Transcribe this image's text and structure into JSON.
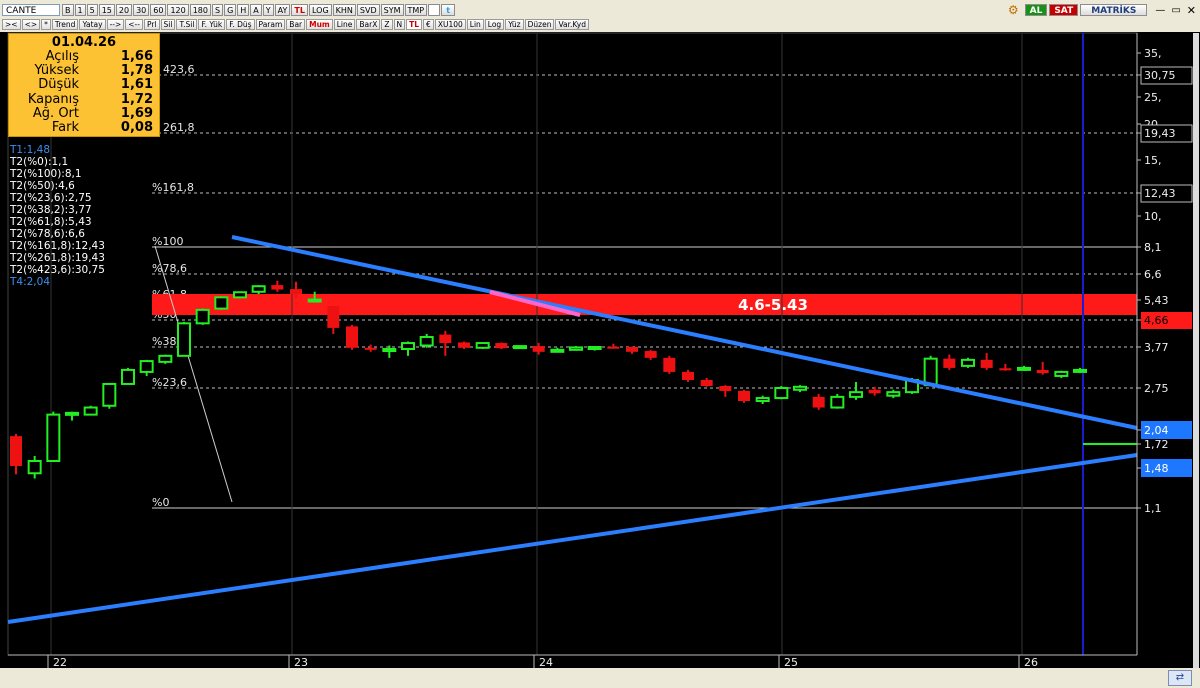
{
  "toolbar": {
    "symbol": "CANTE",
    "row1_buttons": [
      "B",
      "1",
      "5",
      "15",
      "20",
      "30",
      "60",
      "120",
      "180",
      "S",
      "G",
      "H",
      "A",
      "Y",
      "AY",
      "TL",
      "LOG",
      "KHN",
      "SVD",
      "SYM",
      "TMP"
    ],
    "row1_red": [
      "TL"
    ],
    "row2_buttons": [
      "><",
      "<>",
      "*",
      "Trend",
      "Yatay",
      "-->",
      "<--",
      "Prl",
      "Sil",
      "T.Sil",
      "F. Yük",
      "F. Düş",
      "Param",
      "Bar",
      "Mum",
      "Line",
      "BarX",
      "Z",
      "N",
      "TL",
      "€",
      "XU100",
      "Lin",
      "Log",
      "Yüz",
      "Düzen",
      "Var.Kyd"
    ],
    "row2_red": [
      "Mum",
      "TL"
    ],
    "al_label": "AL",
    "sat_label": "SAT",
    "brand": "MATRİKS"
  },
  "info": {
    "date": "01.04.26",
    "rows": [
      {
        "label": "Açılış",
        "value": "1,66"
      },
      {
        "label": "Yüksek",
        "value": "1,78"
      },
      {
        "label": "Düşük",
        "value": "1,61"
      },
      {
        "label": "Kapanış",
        "value": "1,72"
      },
      {
        "label": "Ağ. Ort",
        "value": "1,69"
      },
      {
        "label": "Fark",
        "value": "0,08"
      }
    ]
  },
  "fibonacci": {
    "t1": "T1:1,48",
    "levels": [
      "T2(%0):1,1",
      "T2(%100):8,1",
      "T2(%50):4,6",
      "T2(%23,6):2,75",
      "T2(%38,2):3,77",
      "T2(%61,8):5,43",
      "T2(%78,6):6,6",
      "T2(%161,8):12,43",
      "T2(%261,8):19,43",
      "T2(%423,6):30,75"
    ],
    "t4": "T4:2,04",
    "line_labels": [
      "423,6",
      "261,8",
      "%161,8",
      "%100",
      "%78,6",
      "%61,8",
      "%50",
      "%38,2",
      "%23,6",
      "%0"
    ]
  },
  "zone_label": "4.6-5.43",
  "price_axis": {
    "ticks": [
      "35,",
      "30,75",
      "25,",
      "20,",
      "19,43",
      "15,",
      "12,43",
      "10,",
      "8,1",
      "6,6",
      "5,43",
      "4,66",
      "3,77",
      "2,75",
      "2,04",
      "1,72",
      "1,48",
      "1,1"
    ],
    "highlight_red": "4,66",
    "highlight_blue": [
      "2,04",
      "1,48"
    ]
  },
  "date_axis": [
    "22",
    "23",
    "24",
    "25",
    "26"
  ],
  "colors": {
    "up": "#22ee22",
    "down": "#ee1111",
    "trend": "#2b7fff",
    "zone": "#ff1a1a",
    "info_bg": "#fdc234",
    "cursor": "#1b1bd0"
  },
  "chart_data": {
    "type": "candlestick",
    "candles": [
      {
        "o": 1.9,
        "h": 1.95,
        "l": 1.42,
        "c": 1.5
      },
      {
        "o": 1.43,
        "h": 1.6,
        "l": 1.38,
        "c": 1.55
      },
      {
        "o": 1.55,
        "h": 2.35,
        "l": 1.55,
        "c": 2.3
      },
      {
        "o": 2.3,
        "h": 2.35,
        "l": 2.2,
        "c": 2.33
      },
      {
        "o": 2.3,
        "h": 2.45,
        "l": 2.3,
        "c": 2.42
      },
      {
        "o": 2.45,
        "h": 2.85,
        "l": 2.4,
        "c": 2.85
      },
      {
        "o": 2.85,
        "h": 3.25,
        "l": 2.85,
        "c": 3.2
      },
      {
        "o": 3.15,
        "h": 3.45,
        "l": 3.05,
        "c": 3.42
      },
      {
        "o": 3.4,
        "h": 3.58,
        "l": 3.35,
        "c": 3.55
      },
      {
        "o": 3.55,
        "h": 4.6,
        "l": 3.55,
        "c": 4.55
      },
      {
        "o": 4.55,
        "h": 5.1,
        "l": 4.5,
        "c": 5.05
      },
      {
        "o": 5.1,
        "h": 5.6,
        "l": 5.05,
        "c": 5.55
      },
      {
        "o": 5.55,
        "h": 5.8,
        "l": 5.5,
        "c": 5.78
      },
      {
        "o": 5.8,
        "h": 6.1,
        "l": 5.7,
        "c": 6.05
      },
      {
        "o": 6.1,
        "h": 6.3,
        "l": 5.8,
        "c": 5.9
      },
      {
        "o": 5.92,
        "h": 6.25,
        "l": 5.5,
        "c": 5.7
      },
      {
        "o": 5.45,
        "h": 5.8,
        "l": 5.35,
        "c": 5.45
      },
      {
        "o": 5.2,
        "h": 5.2,
        "l": 4.2,
        "c": 4.4
      },
      {
        "o": 4.45,
        "h": 4.5,
        "l": 3.7,
        "c": 3.75
      },
      {
        "o": 3.75,
        "h": 3.85,
        "l": 3.65,
        "c": 3.7
      },
      {
        "o": 3.7,
        "h": 3.82,
        "l": 3.5,
        "c": 3.72
      },
      {
        "o": 3.72,
        "h": 3.95,
        "l": 3.55,
        "c": 3.9
      },
      {
        "o": 3.82,
        "h": 4.2,
        "l": 3.75,
        "c": 4.1
      },
      {
        "o": 4.18,
        "h": 4.3,
        "l": 3.55,
        "c": 3.9
      },
      {
        "o": 3.92,
        "h": 3.95,
        "l": 3.72,
        "c": 3.75
      },
      {
        "o": 3.75,
        "h": 3.92,
        "l": 3.72,
        "c": 3.9
      },
      {
        "o": 3.9,
        "h": 3.92,
        "l": 3.72,
        "c": 3.74
      },
      {
        "o": 3.76,
        "h": 3.82,
        "l": 3.72,
        "c": 3.8
      },
      {
        "o": 3.8,
        "h": 3.9,
        "l": 3.58,
        "c": 3.65
      },
      {
        "o": 3.67,
        "h": 3.75,
        "l": 3.65,
        "c": 3.7
      },
      {
        "o": 3.7,
        "h": 3.8,
        "l": 3.68,
        "c": 3.76
      },
      {
        "o": 3.75,
        "h": 3.8,
        "l": 3.68,
        "c": 3.77
      },
      {
        "o": 3.78,
        "h": 3.88,
        "l": 3.73,
        "c": 3.75
      },
      {
        "o": 3.77,
        "h": 3.78,
        "l": 3.6,
        "c": 3.65
      },
      {
        "o": 3.67,
        "h": 3.7,
        "l": 3.45,
        "c": 3.5
      },
      {
        "o": 3.5,
        "h": 3.55,
        "l": 3.1,
        "c": 3.15
      },
      {
        "o": 3.15,
        "h": 3.2,
        "l": 2.9,
        "c": 2.95
      },
      {
        "o": 2.95,
        "h": 3.0,
        "l": 2.78,
        "c": 2.8
      },
      {
        "o": 2.8,
        "h": 2.82,
        "l": 2.6,
        "c": 2.7
      },
      {
        "o": 2.7,
        "h": 2.72,
        "l": 2.5,
        "c": 2.53
      },
      {
        "o": 2.53,
        "h": 2.62,
        "l": 2.48,
        "c": 2.58
      },
      {
        "o": 2.58,
        "h": 2.8,
        "l": 2.56,
        "c": 2.75
      },
      {
        "o": 2.72,
        "h": 2.82,
        "l": 2.68,
        "c": 2.78
      },
      {
        "o": 2.6,
        "h": 2.65,
        "l": 2.38,
        "c": 2.42
      },
      {
        "o": 2.42,
        "h": 2.65,
        "l": 2.4,
        "c": 2.6
      },
      {
        "o": 2.6,
        "h": 2.9,
        "l": 2.55,
        "c": 2.68
      },
      {
        "o": 2.72,
        "h": 2.78,
        "l": 2.62,
        "c": 2.66
      },
      {
        "o": 2.62,
        "h": 2.72,
        "l": 2.58,
        "c": 2.68
      },
      {
        "o": 2.68,
        "h": 3.0,
        "l": 2.65,
        "c": 2.95
      },
      {
        "o": 2.82,
        "h": 3.55,
        "l": 2.8,
        "c": 3.48
      },
      {
        "o": 3.48,
        "h": 3.58,
        "l": 3.2,
        "c": 3.25
      },
      {
        "o": 3.3,
        "h": 3.5,
        "l": 3.25,
        "c": 3.45
      },
      {
        "o": 3.45,
        "h": 3.62,
        "l": 3.2,
        "c": 3.25
      },
      {
        "o": 3.24,
        "h": 3.35,
        "l": 3.18,
        "c": 3.2
      },
      {
        "o": 3.2,
        "h": 3.3,
        "l": 3.18,
        "c": 3.25
      },
      {
        "o": 3.2,
        "h": 3.4,
        "l": 3.08,
        "c": 3.12
      },
      {
        "o": 3.05,
        "h": 3.18,
        "l": 3.0,
        "c": 3.15
      },
      {
        "o": 3.15,
        "h": 3.25,
        "l": 3.12,
        "c": 3.2
      }
    ]
  }
}
